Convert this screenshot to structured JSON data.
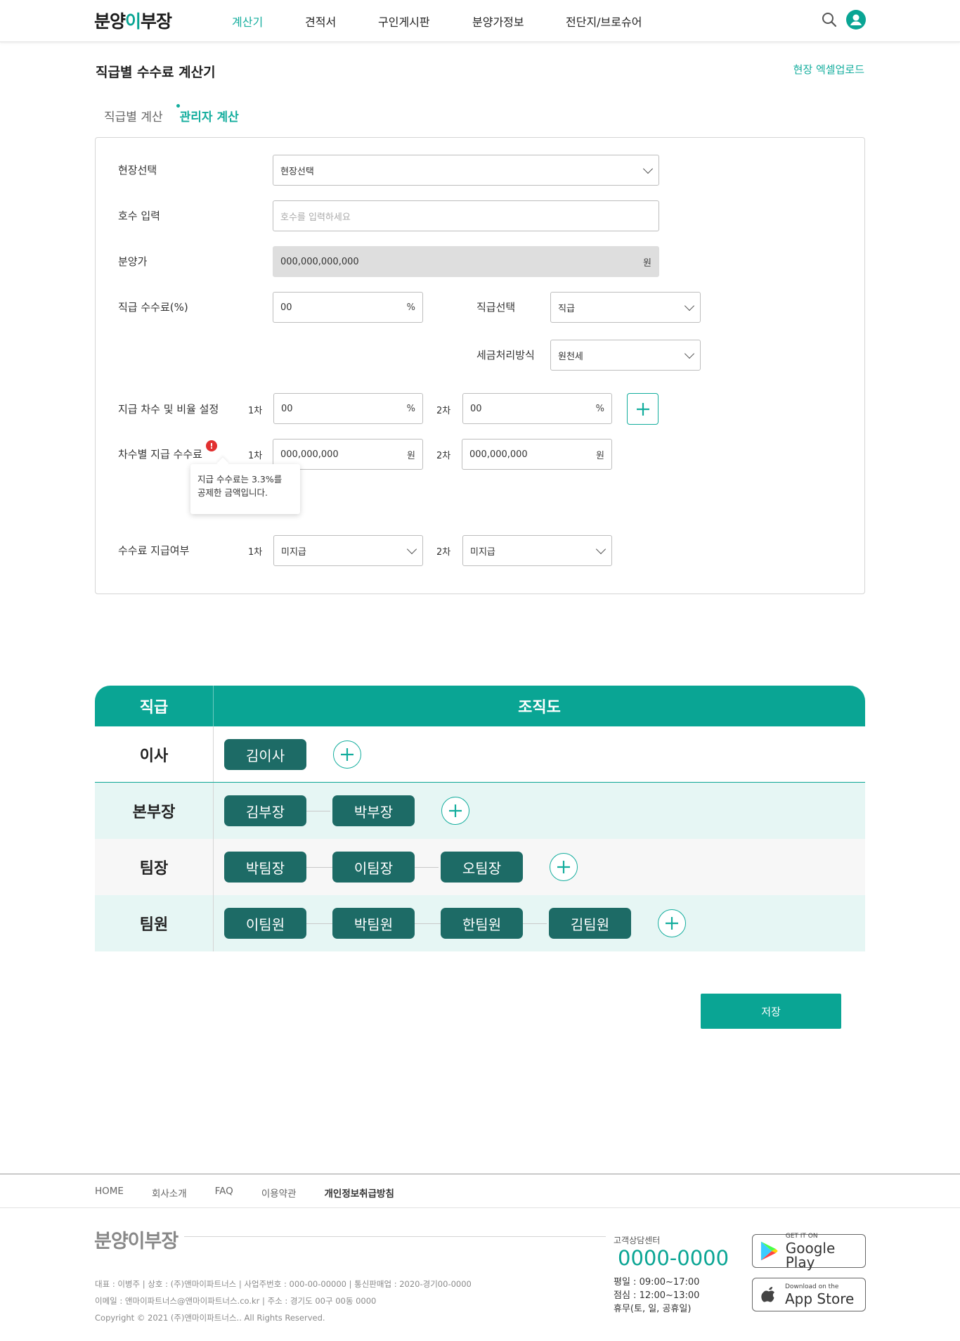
{
  "header": {
    "logo_pre": "분양",
    "logo_accent": "이",
    "logo_post": "부장",
    "nav": [
      "계산기",
      "견적서",
      "구인게시판",
      "분양가정보",
      "전단지/브로슈어"
    ],
    "active_nav": "계산기"
  },
  "page": {
    "title": "직급별 수수료 계산기",
    "excel_link": "현장 엑셀업로드",
    "tabs": [
      "직급별 계산",
      "관리자 계산"
    ],
    "active_tab": "관리자 계산"
  },
  "form": {
    "site_label": "현장선택",
    "site_value": "현장선택",
    "unit_label": "호수 입력",
    "unit_placeholder": "호수를 입력하세요",
    "price_label": "분양가",
    "price_value": "000,000,000,000",
    "price_unit": "원",
    "fee_label": "직급 수수료(%)",
    "fee_value": "00",
    "fee_unit": "%",
    "rank_label": "직급선택",
    "rank_value": "직급",
    "tax_label": "세금처리방식",
    "tax_value": "원천세",
    "ratio_label": "지급 차수 및 비율 설정",
    "round1": "1차",
    "round2": "2차",
    "ratio1": "00",
    "ratio2": "00",
    "ratio_unit": "%",
    "amount_label": "차수별 지급 수수료",
    "amount1": "000,000,000",
    "amount2": "000,000,000",
    "amount_unit": "원",
    "tooltip_line1": "지급 수수료는 3.3%를",
    "tooltip_line2": "공제한 금액입니다.",
    "status_label": "수수료 지급여부",
    "status1": "미지급",
    "status2": "미지급"
  },
  "org": {
    "head_rank": "직급",
    "head_chart": "조직도",
    "rows": [
      {
        "rank": "이사",
        "members": [
          "김이사"
        ]
      },
      {
        "rank": "본부장",
        "members": [
          "김부장",
          "박부장"
        ]
      },
      {
        "rank": "팀장",
        "members": [
          "박팀장",
          "이팀장",
          "오팀장"
        ]
      },
      {
        "rank": "팀원",
        "members": [
          "이팀원",
          "박팀원",
          "한팀원",
          "김팀원"
        ]
      }
    ]
  },
  "save_label": "저장",
  "footer": {
    "nav": [
      "HOME",
      "회사소개",
      "FAQ",
      "이용약관",
      "개인정보취급방침"
    ],
    "logo_text": "분양이부장",
    "info1": "대표 : 이병주 | 상호 : (주)앤마이파트너스 | 사업주번호 : 000-00-00000 | 통신판매업 : 2020-경기00-0000",
    "info2": "이메일 : 앤마이파트너스@앤마이파트너스.co.kr | 주소 : 경기도 00구 00동 0000",
    "copyright": "Copyright © 2021 (주)앤마이파트너스.. All Rights Reserved.",
    "cs_label": "고객상담센터",
    "cs_number": "0000-0000",
    "hours_weekday": "평일 : 09:00~17:00",
    "hours_lunch": "점심 : 12:00~13:00",
    "hours_off": "휴무(토, 일, 공휴일)",
    "gp_small": "GET IT ON",
    "gp_big": "Google Play",
    "as_small": "Download on the",
    "as_big": "App Store"
  },
  "colors": {
    "accent": "#0aa594",
    "chip": "#1d6b66",
    "row_tint": "#e6f6f4"
  }
}
